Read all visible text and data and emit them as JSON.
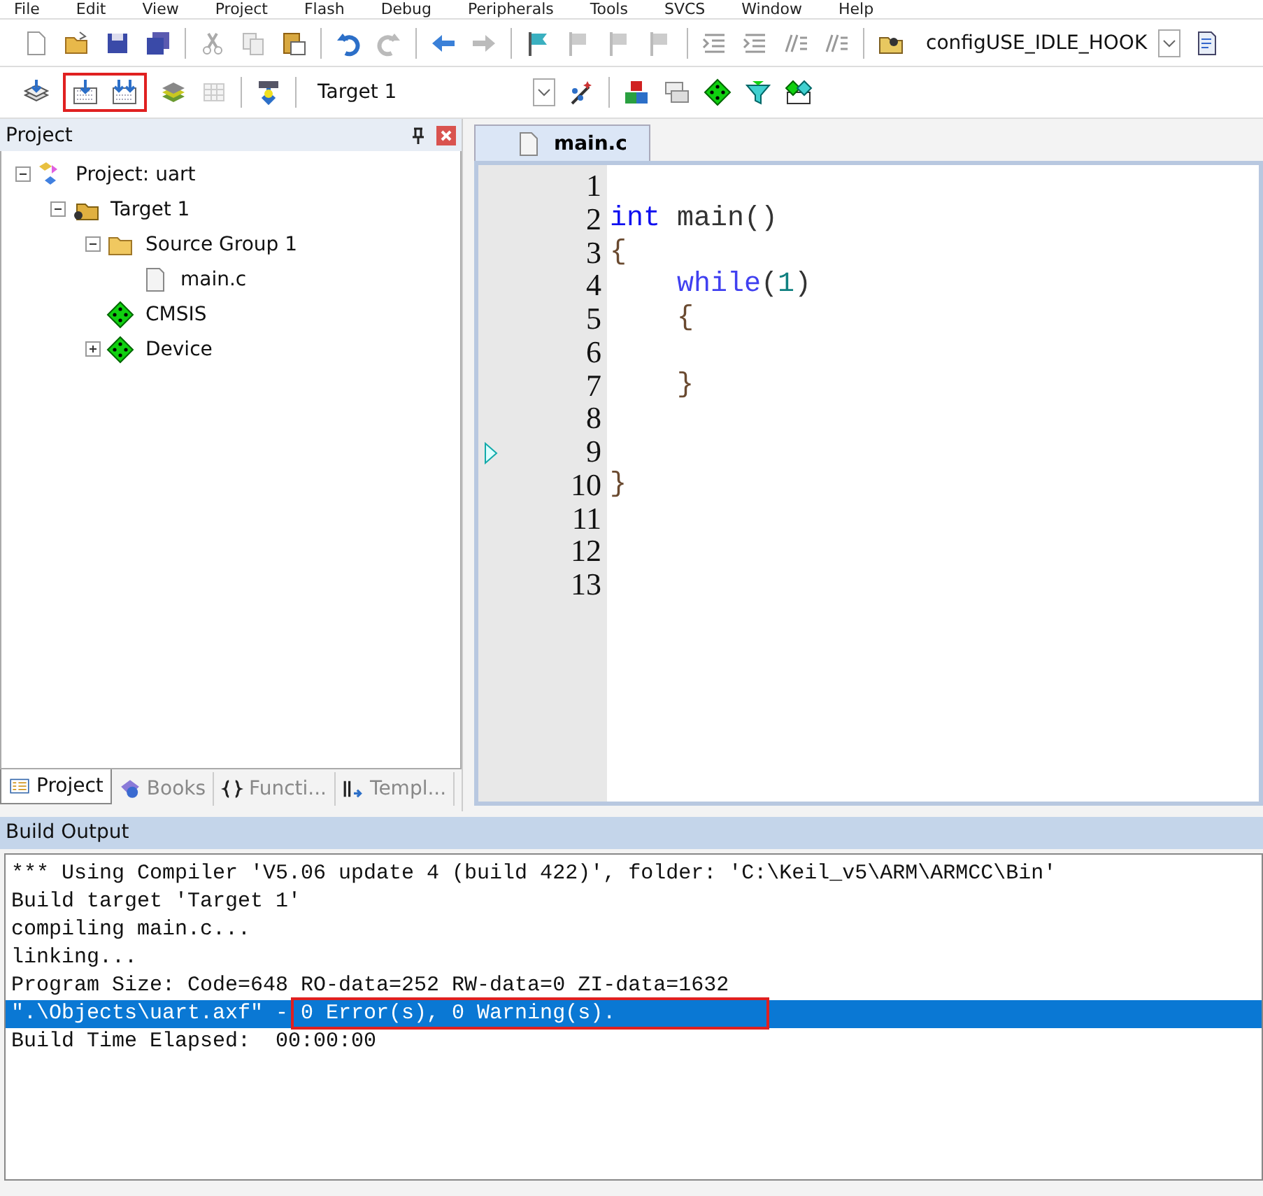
{
  "menu": [
    "File",
    "Edit",
    "View",
    "Project",
    "Flash",
    "Debug",
    "Peripherals",
    "Tools",
    "SVCS",
    "Window",
    "Help"
  ],
  "toolbar": {
    "define_combo": {
      "value": "configUSE_IDLE_HOOK"
    },
    "target_combo": {
      "value": "Target 1"
    }
  },
  "project_panel": {
    "title": "Project",
    "tree": [
      {
        "label": "Project: uart",
        "kind": "project",
        "has_toggle": true,
        "expanded": true,
        "children": [
          {
            "label": "Target 1",
            "kind": "target",
            "has_toggle": true,
            "expanded": true,
            "children": [
              {
                "label": "Source Group 1",
                "kind": "folder",
                "has_toggle": true,
                "expanded": true,
                "children": [
                  {
                    "label": "main.c",
                    "kind": "file",
                    "has_toggle": false
                  }
                ]
              },
              {
                "label": "CMSIS",
                "kind": "component",
                "has_toggle": false
              },
              {
                "label": "Device",
                "kind": "component",
                "has_toggle": true,
                "expanded": false
              }
            ]
          }
        ]
      }
    ],
    "tabs": [
      {
        "label": "Project",
        "kind": "project",
        "selected": true
      },
      {
        "label": "Books",
        "kind": "books",
        "selected": false
      },
      {
        "label": "Functi...",
        "kind": "functions",
        "selected": false
      },
      {
        "label": "Templ...",
        "kind": "templates",
        "selected": false
      }
    ]
  },
  "editor": {
    "tabs": [
      {
        "label": "main.c",
        "selected": true
      }
    ],
    "lines": [
      {
        "number": "1",
        "marker": false
      },
      {
        "number": "2",
        "marker": false,
        "indented": false,
        "tokens": [
          {
            "kind": "keyword",
            "text": "int"
          },
          {
            "kind": "plain",
            "text": " main()"
          }
        ]
      },
      {
        "number": "3",
        "marker": false,
        "indented": false,
        "tokens": [
          {
            "kind": "punct",
            "text": "{"
          }
        ]
      },
      {
        "number": "4",
        "marker": false,
        "indented": true,
        "tokens": [
          {
            "kind": "keyword2",
            "text": "while"
          },
          {
            "kind": "plain",
            "text": "("
          },
          {
            "kind": "number",
            "text": "1"
          },
          {
            "kind": "plain",
            "text": ")"
          }
        ]
      },
      {
        "number": "5",
        "marker": false,
        "indented": true,
        "tokens": [
          {
            "kind": "punct",
            "text": "{"
          }
        ]
      },
      {
        "number": "6",
        "marker": false
      },
      {
        "number": "7",
        "marker": false,
        "indented": true,
        "tokens": [
          {
            "kind": "punct",
            "text": "}"
          }
        ]
      },
      {
        "number": "8",
        "marker": false
      },
      {
        "number": "9",
        "marker": true
      },
      {
        "number": "10",
        "marker": false,
        "indented": false,
        "tokens": [
          {
            "kind": "punct",
            "text": "}"
          }
        ]
      },
      {
        "number": "11",
        "marker": false
      },
      {
        "number": "12",
        "marker": false
      },
      {
        "number": "13",
        "marker": false
      }
    ]
  },
  "build_output": {
    "title": "Build Output",
    "lines": [
      {
        "text": "*** Using Compiler 'V5.06 update 4 (build 422)', folder: 'C:\\Keil_v5\\ARM\\ARMCC\\Bin'",
        "selected": false
      },
      {
        "text": "Build target 'Target 1'",
        "selected": false
      },
      {
        "text": "compiling main.c...",
        "selected": false
      },
      {
        "text": "linking...",
        "selected": false
      },
      {
        "text": "Program Size: Code=648 RO-data=252 RW-data=0 ZI-data=1632",
        "selected": false
      },
      {
        "text": "\".\\Objects\\uart.axf\" - 0 Error(s), 0 Warning(s).",
        "selected": true
      },
      {
        "text": "Build Time Elapsed:  00:00:00",
        "selected": false
      }
    ]
  }
}
